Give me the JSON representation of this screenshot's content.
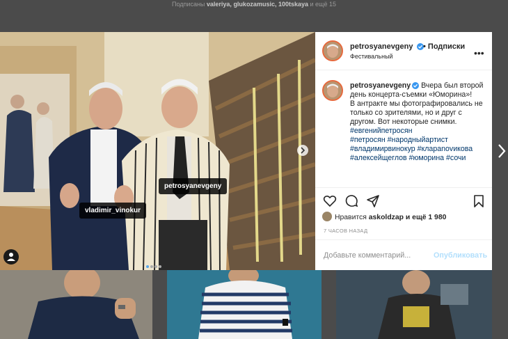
{
  "top_caption": {
    "prefix": "Подписаны",
    "names": "valeriya, glukozamusic, 100tskaya",
    "suffix": "и ещё 15"
  },
  "photo": {
    "tags": [
      "vladimir_vinokur",
      "petrosyanevgeny"
    ]
  },
  "post": {
    "username": "petrosyanevgeny",
    "follow_label": "Подписки",
    "location": "Фестивальный",
    "caption_intro": "Вчера был второй день концерта-съемки «Юморина»!",
    "caption_text": "В антракте мы фотографировались не только со зрителями, но и друг с другом. Вот некоторые снимки.",
    "hashtags": [
      "#евгенийпетросян",
      "#петросян",
      "#народныйартист",
      "#владимирвинокур",
      "#клараnovикова",
      "#алексейщеглов",
      "#юморина",
      "#сочи"
    ],
    "likes_prefix": "Нравится",
    "likes_user": "askoldzap",
    "likes_suffix": "и ещё 1 980",
    "time_ago": "7 ЧАСОВ НАЗАД",
    "comment_placeholder": "Добавьте комментарий...",
    "publish_label": "Опубликовать"
  },
  "colors": {
    "verified": "#3897f0",
    "hashtag": "#00376b",
    "publish_disabled": "#b2dffc"
  },
  "icons": [
    "heart-icon",
    "comment-icon",
    "share-icon",
    "bookmark-icon",
    "more-icon",
    "verified-icon",
    "user-tag-icon",
    "chevron-right-icon"
  ]
}
